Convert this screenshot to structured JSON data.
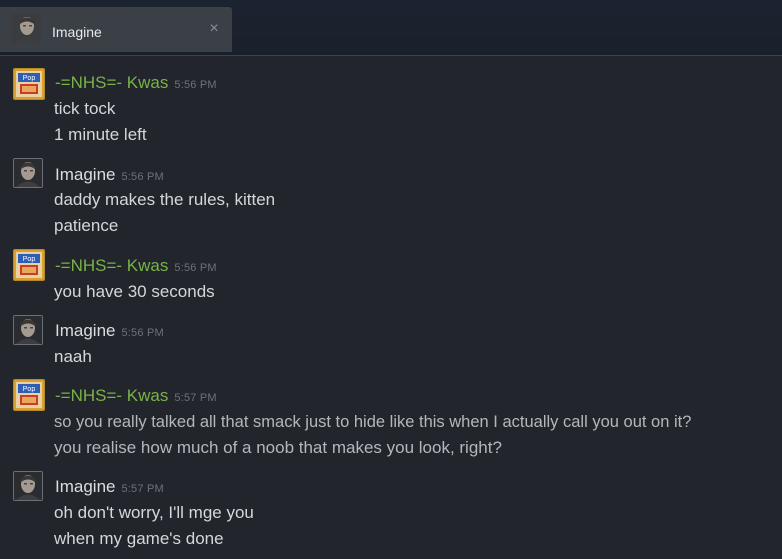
{
  "tab": {
    "title": "Imagine",
    "close_glyph": "×",
    "avatar_icon": "user-avatar-icon"
  },
  "colors": {
    "background": "#22252b",
    "tab_active": "#3b3f46",
    "name_kwas": "#79b347",
    "name_imagine": "#dadde1",
    "timestamp": "#6c727b",
    "message_text": "#d4d7db"
  },
  "messages": [
    {
      "sender": "-=NHS=- Kwas",
      "time": "5:56 PM",
      "lines": [
        "tick tock",
        "1 minute left"
      ]
    },
    {
      "sender": "Imagine",
      "time": "5:56 PM",
      "lines": [
        "daddy makes the rules, kitten",
        "patience"
      ]
    },
    {
      "sender": "-=NHS=- Kwas",
      "time": "5:56 PM",
      "lines": [
        "you have 30 seconds"
      ]
    },
    {
      "sender": "Imagine",
      "time": "5:56 PM",
      "lines": [
        "naah"
      ]
    },
    {
      "sender": "-=NHS=- Kwas",
      "time": "5:57 PM",
      "lines": [
        "so you really talked all that smack just to hide like this when I actually call you out on it?",
        "you realise how much of a noob that makes you look, right?"
      ]
    },
    {
      "sender": "Imagine",
      "time": "5:57 PM",
      "lines": [
        "oh don't worry, I'll mge you",
        "when my game's done"
      ]
    }
  ]
}
